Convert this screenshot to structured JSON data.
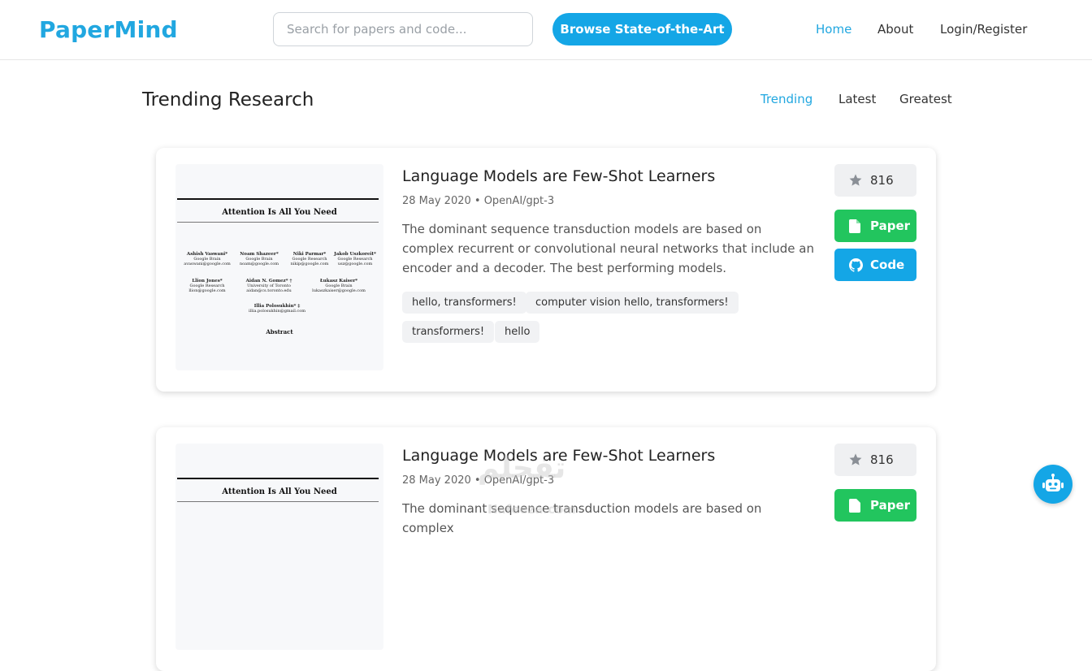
{
  "header": {
    "logo": "PaperMind",
    "search_placeholder": "Search for papers and code...",
    "browse_label": "Browse State-of-the-Art",
    "nav": [
      "Home",
      "About",
      "Login/Register"
    ],
    "accent": "#21a7e0"
  },
  "section": {
    "title": "Trending Research",
    "tabs": [
      "Trending",
      "Latest",
      "Greatest"
    ]
  },
  "thumbnail": {
    "paper_title": "Attention Is All You Need",
    "abstract_heading": "Abstract",
    "authors": [
      {
        "name": "Ashish Vaswani*",
        "org": "Google Brain",
        "email": "avaswani@google.com"
      },
      {
        "name": "Noam Shazeer*",
        "org": "Google Brain",
        "email": "noam@google.com"
      },
      {
        "name": "Niki Parmar*",
        "org": "Google Research",
        "email": "nikip@google.com"
      },
      {
        "name": "Jakob Uszkoreit*",
        "org": "Google Research",
        "email": "usz@google.com"
      },
      {
        "name": "Llion Jones*",
        "org": "Google Research",
        "email": "llion@google.com"
      },
      {
        "name": "Aidan N. Gomez* †",
        "org": "University of Toronto",
        "email": "aidan@cs.toronto.edu"
      },
      {
        "name": "Łukasz Kaiser*",
        "org": "Google Brain",
        "email": "lukaszkaiser@google.com"
      },
      {
        "name": "Illia Polosukhin* ‡",
        "org": "",
        "email": "illia.polosukhin@gmail.com"
      }
    ]
  },
  "cards": [
    {
      "title": "Language Models are Few-Shot Learners",
      "meta": "28 May 2020 • OpenAI/gpt-3",
      "description": "The dominant sequence transduction models are based on complex recurrent or convolutional neural networks that include an encoder and a decoder. The best performing models.",
      "tags": [
        "hello, transformers!",
        "computer vision hello, transformers!",
        "transformers!",
        "hello"
      ],
      "stars": "816",
      "paper_label": "Paper",
      "code_label": "Code"
    },
    {
      "title": "Language Models are Few-Shot Learners",
      "meta": "28 May 2020 • OpenAI/gpt-3",
      "description": "The dominant sequence transduction models are based on complex",
      "stars": "816",
      "paper_label": "Paper"
    }
  ],
  "watermark": {
    "text_ar": "تفحلم",
    "text_en": "Nafeeza.com"
  }
}
